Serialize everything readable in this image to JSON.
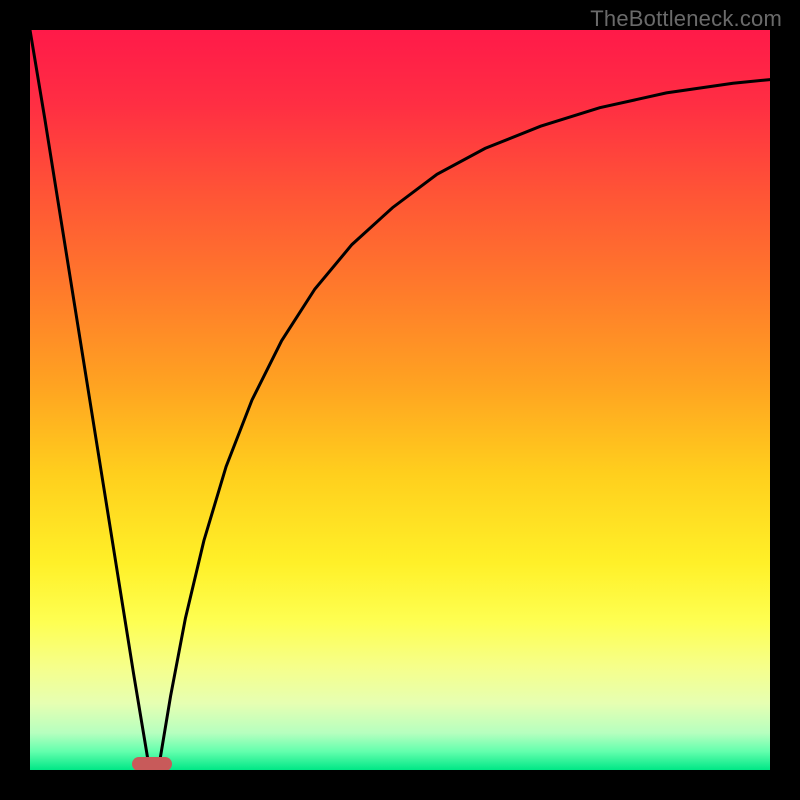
{
  "watermark": "TheBottleneck.com",
  "plot": {
    "marker": {
      "x_frac": 0.165,
      "y_frac": 0.992
    }
  },
  "gradient_stops": [
    {
      "pos": 0.0,
      "color": "#ff1a49"
    },
    {
      "pos": 0.1,
      "color": "#ff2e43"
    },
    {
      "pos": 0.22,
      "color": "#ff5436"
    },
    {
      "pos": 0.35,
      "color": "#ff7a2b"
    },
    {
      "pos": 0.48,
      "color": "#ffa321"
    },
    {
      "pos": 0.6,
      "color": "#ffcf1d"
    },
    {
      "pos": 0.72,
      "color": "#fff028"
    },
    {
      "pos": 0.8,
      "color": "#feff52"
    },
    {
      "pos": 0.86,
      "color": "#f6ff8a"
    },
    {
      "pos": 0.91,
      "color": "#e6ffb2"
    },
    {
      "pos": 0.95,
      "color": "#b6ffbf"
    },
    {
      "pos": 0.975,
      "color": "#63ffad"
    },
    {
      "pos": 1.0,
      "color": "#00e786"
    }
  ],
  "chart_data": {
    "type": "line",
    "title": "",
    "xlabel": "",
    "ylabel": "",
    "xlim": [
      0,
      1
    ],
    "ylim": [
      0,
      1
    ],
    "series": [
      {
        "name": "left-branch",
        "x": [
          0.0,
          0.02,
          0.04,
          0.06,
          0.08,
          0.1,
          0.12,
          0.14,
          0.16
        ],
        "y": [
          1.0,
          0.88,
          0.755,
          0.63,
          0.505,
          0.38,
          0.255,
          0.13,
          0.01
        ]
      },
      {
        "name": "right-branch",
        "x": [
          0.175,
          0.19,
          0.21,
          0.235,
          0.265,
          0.3,
          0.34,
          0.385,
          0.435,
          0.49,
          0.55,
          0.615,
          0.69,
          0.77,
          0.86,
          0.95,
          1.0
        ],
        "y": [
          0.01,
          0.1,
          0.205,
          0.31,
          0.41,
          0.5,
          0.58,
          0.65,
          0.71,
          0.76,
          0.805,
          0.84,
          0.87,
          0.895,
          0.915,
          0.928,
          0.933
        ]
      }
    ],
    "marker": {
      "x": 0.165,
      "y": 0.008
    },
    "background": "vertical-gradient red→orange→yellow→green"
  }
}
